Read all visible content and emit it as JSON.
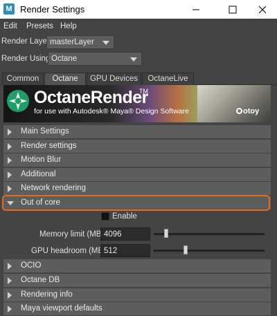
{
  "window": {
    "app_icon": "M",
    "title": "Render Settings",
    "minimize_icon": "minimize-icon",
    "maximize_icon": "maximize-icon",
    "close_icon": "close-icon"
  },
  "menu": [
    "Edit",
    "Presets",
    "Help"
  ],
  "render_layer": {
    "label": "Render Layer",
    "value": "masterLayer"
  },
  "render_using": {
    "label": "Render Using",
    "value": "Octane"
  },
  "tabs": [
    {
      "label": "Common",
      "active": false
    },
    {
      "label": "Octane",
      "active": true
    },
    {
      "label": "GPU Devices",
      "active": false
    },
    {
      "label": "OctaneLive",
      "active": false
    }
  ],
  "banner": {
    "brand": "OctaneRender",
    "tm": "TM",
    "subtitle": "for use with Autodesk® Maya® Design Software",
    "vendor": "otoy"
  },
  "sections_top": [
    "Main Settings",
    "Render settings",
    "Motion Blur",
    "Additional",
    "Network rendering"
  ],
  "out_of_core": {
    "title": "Out of core",
    "enable_label": "Enable",
    "memory_limit": {
      "label": "Memory limit (MB)",
      "value": "4096",
      "slider_fraction": 0.11
    },
    "gpu_headroom": {
      "label": "GPU headroom (MB)",
      "value": "512",
      "slider_fraction": 0.29
    }
  },
  "sections_bottom": [
    "OCIO",
    "Octane DB",
    "Rendering info",
    "Maya viewport defaults"
  ],
  "colors": {
    "highlight": "#e26a1a",
    "panel": "#444444",
    "section": "#5d5d5d"
  }
}
